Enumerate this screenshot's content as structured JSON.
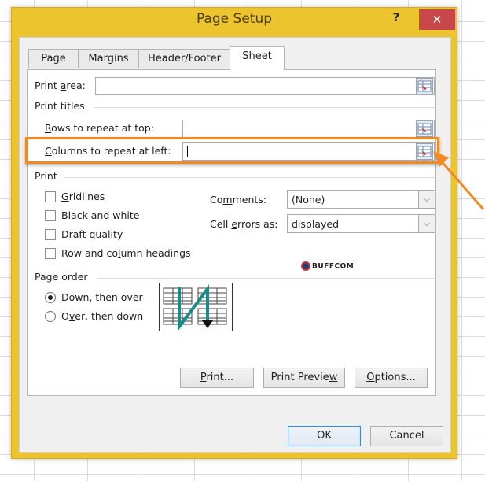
{
  "dialog": {
    "title": "Page Setup",
    "help_label": "?",
    "close_label": "✕",
    "tabs": [
      {
        "label": "Page",
        "active": false
      },
      {
        "label": "Margins",
        "active": false
      },
      {
        "label": "Header/Footer",
        "active": false
      },
      {
        "label": "Sheet",
        "active": true
      }
    ],
    "print_area": {
      "label_pre": "Print ",
      "label_u": "a",
      "label_post": "rea:",
      "value": ""
    },
    "print_titles": {
      "heading": "Print titles",
      "rows": {
        "label_u": "R",
        "label_post": "ows to repeat at top:",
        "value": ""
      },
      "columns": {
        "label_u": "C",
        "label_post": "olumns to repeat at left:",
        "value": ""
      }
    },
    "print": {
      "heading": "Print",
      "checkboxes": [
        {
          "pre": "",
          "u": "G",
          "post": "ridlines",
          "checked": false
        },
        {
          "pre": "",
          "u": "B",
          "post": "lack and white",
          "checked": false
        },
        {
          "pre": "Draft ",
          "u": "q",
          "post": "uality",
          "checked": false
        },
        {
          "pre": "Row and co",
          "u": "l",
          "post": "umn headings",
          "checked": false
        }
      ],
      "comments": {
        "pre": "Co",
        "u": "m",
        "post": "ments:",
        "value": "(None)"
      },
      "cell_errors": {
        "pre": "Cell ",
        "u": "e",
        "post": "rrors as:",
        "value": "displayed"
      }
    },
    "watermark": "BUFFCOM",
    "page_order": {
      "heading": "Page order",
      "options": [
        {
          "pre": "",
          "u": "D",
          "post": "own, then over",
          "selected": true
        },
        {
          "pre": "O",
          "u": "v",
          "post": "er, then down",
          "selected": false
        }
      ]
    },
    "buttons": {
      "print": {
        "u": "P",
        "post": "rint..."
      },
      "print_preview": {
        "pre": "Print Previe",
        "u": "w"
      },
      "options": {
        "u": "O",
        "post": "ptions..."
      },
      "ok": "OK",
      "cancel": "Cancel"
    },
    "colors": {
      "frame": "#ecc42e",
      "close": "#c8474a",
      "highlight": "#f08a24",
      "diagram_arrow": "#1d8a8a"
    }
  }
}
